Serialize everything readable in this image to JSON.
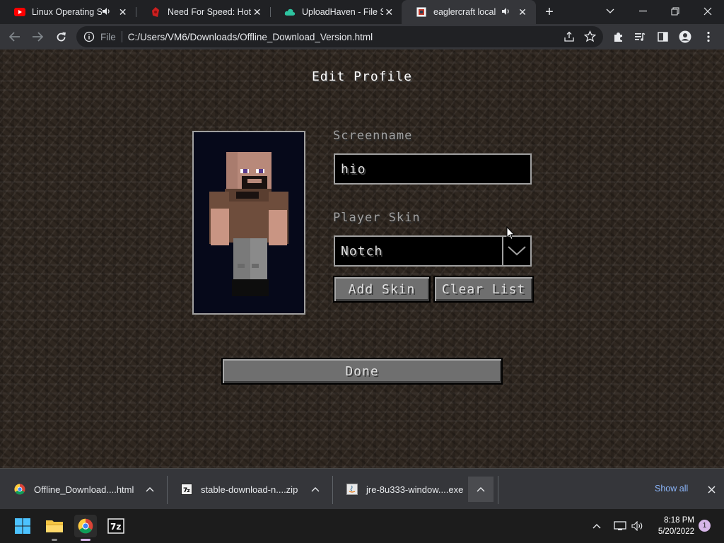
{
  "browser": {
    "tabs": [
      {
        "title": "Linux Operating Sy",
        "icon": "youtube-icon",
        "audio": true
      },
      {
        "title": "Need For Speed: Hot P",
        "icon": "game-site-icon",
        "audio": false
      },
      {
        "title": "UploadHaven - File Sha",
        "icon": "cloud-icon",
        "audio": false
      },
      {
        "title": "eaglercraft local",
        "icon": "page-icon",
        "audio": true,
        "active": true
      }
    ],
    "address": {
      "protocol": "File",
      "url": "C:/Users/VM6/Downloads/Offline_Download_Version.html"
    }
  },
  "game": {
    "title": "Edit Profile",
    "screenname_label": "Screenname",
    "screenname_value": "hio",
    "skin_label": "Player Skin",
    "skin_value": "Notch",
    "add_skin": "Add Skin",
    "clear_list": "Clear List",
    "done": "Done"
  },
  "downloads": {
    "items": [
      {
        "name": "Offline_Download....html",
        "icon": "chrome-icon"
      },
      {
        "name": "stable-download-n....zip",
        "icon": "zip-archive-icon"
      },
      {
        "name": "jre-8u333-window....exe",
        "icon": "java-installer-icon"
      }
    ],
    "show_all": "Show all"
  },
  "taskbar": {
    "time": "8:18 PM",
    "date": "5/20/2022",
    "notifications": "1",
    "pinned": [
      "windows-start-icon",
      "file-explorer-icon",
      "chrome-icon",
      "7zip-icon"
    ]
  },
  "colors": {
    "tab_strip": "#202124",
    "toolbar": "#35363a",
    "link": "#8ab4f8",
    "game_label": "#a0a0a0",
    "game_button": "#6f6f6f"
  }
}
